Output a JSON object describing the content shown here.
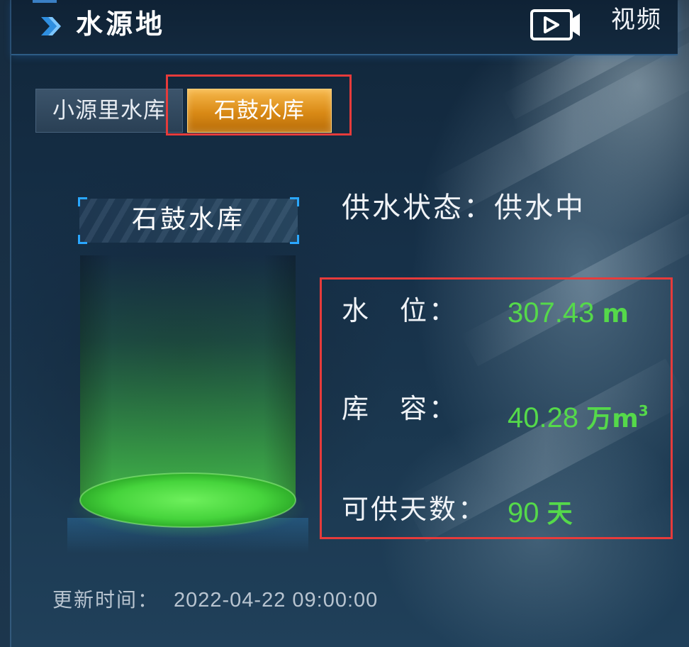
{
  "header": {
    "title": "水源地",
    "video_label": "视频"
  },
  "tabs": [
    {
      "label": "小源里水库",
      "active": false
    },
    {
      "label": "石鼓水库",
      "active": true
    }
  ],
  "reservoir": {
    "name": "石鼓水库",
    "status_label": "供水状态：",
    "status_value": "供水中",
    "water_level_label": "水　位：",
    "water_level_value": "307.43",
    "water_level_unit": "m",
    "capacity_label": "库　容：",
    "capacity_value": "40.28",
    "capacity_unit": "万m",
    "capacity_unit_sup": "3",
    "supply_days_label": "可供天数：",
    "supply_days_value": "90",
    "supply_days_unit": "天"
  },
  "footer": {
    "update_label": "更新时间：",
    "update_value": "2022-04-22 09:00:00"
  },
  "colors": {
    "accent_blue": "#2aa7ff",
    "active_tab": "#e99a24",
    "value_green": "#55d94a",
    "highlight_red": "#e63b3b"
  },
  "icons": {
    "header": "chevron-right-icon",
    "video": "video-play-icon"
  }
}
